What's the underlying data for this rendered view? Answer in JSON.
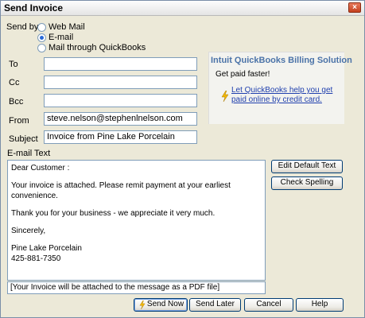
{
  "window": {
    "title": "Send Invoice"
  },
  "send_by": {
    "label": "Send by",
    "options": [
      {
        "label": "Web Mail",
        "checked": false
      },
      {
        "label": "E-mail",
        "checked": true
      },
      {
        "label": "Mail through QuickBooks",
        "checked": false
      }
    ]
  },
  "fields": {
    "to": {
      "label": "To",
      "value": ""
    },
    "cc": {
      "label": "Cc",
      "value": ""
    },
    "bcc": {
      "label": "Bcc",
      "value": ""
    },
    "from": {
      "label": "From",
      "value": "steve.nelson@stephenlnelson.com"
    },
    "subject": {
      "label": "Subject",
      "value": "Invoice from Pine Lake Porcelain"
    }
  },
  "promo": {
    "title": "Intuit QuickBooks Billing Solution",
    "subtitle": "Get paid faster!",
    "link": "Let QuickBooks help you get paid online by credit card."
  },
  "email_text": {
    "label": "E-mail Text",
    "line1": "Dear Customer :",
    "line2": "Your invoice is attached.  Please remit payment at your earliest convenience.",
    "line3": "Thank you for your business - we appreciate it very much.",
    "line4": "Sincerely,",
    "line5": "Pine Lake Porcelain",
    "line6": "425-881-7350"
  },
  "attachment_note": "[Your Invoice will be attached to the message as a PDF file]",
  "buttons": {
    "edit_default_text": "Edit Default Text",
    "check_spelling": "Check Spelling",
    "send_now": "Send Now",
    "send_later": "Send Later",
    "cancel": "Cancel",
    "help": "Help"
  },
  "icons": {
    "close": "close-icon",
    "bolt": "lightning-bolt-icon",
    "send": "lightning-bolt-icon"
  },
  "colors": {
    "promo_title": "#4b73a8",
    "link": "#1f3fae",
    "bolt": "#f2b705"
  }
}
